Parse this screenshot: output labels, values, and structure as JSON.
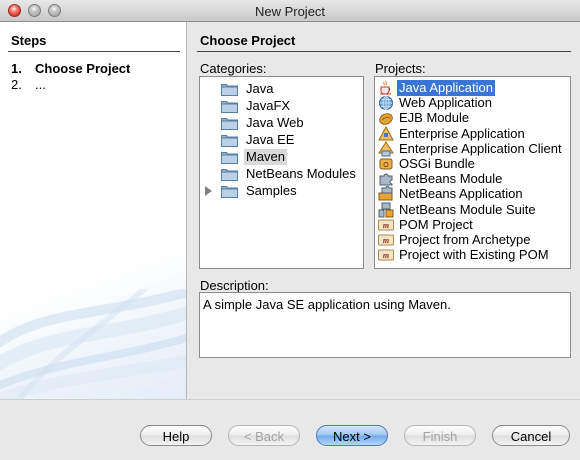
{
  "window": {
    "title": "New Project"
  },
  "steps": {
    "heading": "Steps",
    "items": [
      {
        "num": "1.",
        "label": "Choose Project",
        "current": true
      },
      {
        "num": "2.",
        "label": "...",
        "current": false
      }
    ]
  },
  "main": {
    "heading": "Choose Project",
    "categories_label": "Categories:",
    "projects_label": "Projects:",
    "description_label": "Description:",
    "description": "A simple Java SE application using Maven.",
    "categories": [
      {
        "label": "Java",
        "selected": false,
        "expandable": false
      },
      {
        "label": "JavaFX",
        "selected": false,
        "expandable": false
      },
      {
        "label": "Java Web",
        "selected": false,
        "expandable": false
      },
      {
        "label": "Java EE",
        "selected": false,
        "expandable": false
      },
      {
        "label": "Maven",
        "selected": true,
        "expandable": false
      },
      {
        "label": "NetBeans Modules",
        "selected": false,
        "expandable": false
      },
      {
        "label": "Samples",
        "selected": false,
        "expandable": true
      }
    ],
    "projects": [
      {
        "label": "Java Application",
        "icon": "java-cup-icon",
        "selected": true
      },
      {
        "label": "Web Application",
        "icon": "globe-icon",
        "selected": false
      },
      {
        "label": "EJB Module",
        "icon": "bean-icon",
        "selected": false
      },
      {
        "label": "Enterprise Application",
        "icon": "enterprise-triangle-icon",
        "selected": false
      },
      {
        "label": "Enterprise Application Client",
        "icon": "enterprise-client-icon",
        "selected": false
      },
      {
        "label": "OSGi Bundle",
        "icon": "osgi-icon",
        "selected": false
      },
      {
        "label": "NetBeans Module",
        "icon": "puzzle-icon",
        "selected": false
      },
      {
        "label": "NetBeans Application",
        "icon": "puzzle-stack-icon",
        "selected": false
      },
      {
        "label": "NetBeans Module Suite",
        "icon": "puzzle-group-icon",
        "selected": false
      },
      {
        "label": "POM Project",
        "icon": "maven-icon",
        "selected": false
      },
      {
        "label": "Project from Archetype",
        "icon": "maven-icon",
        "selected": false
      },
      {
        "label": "Project with Existing POM",
        "icon": "maven-icon",
        "selected": false
      }
    ]
  },
  "buttons": {
    "help": "Help",
    "back": "< Back",
    "next": "Next >",
    "finish": "Finish",
    "cancel": "Cancel"
  }
}
